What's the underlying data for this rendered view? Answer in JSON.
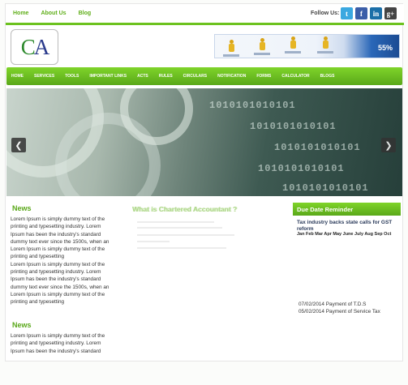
{
  "top_nav": [
    "Home",
    "About Us",
    "Blog"
  ],
  "follow_label": "Follow Us:",
  "social": [
    {
      "name": "twitter-icon",
      "glyph": "t",
      "color": "#3aa8e0"
    },
    {
      "name": "facebook-icon",
      "glyph": "f",
      "color": "#3b5ea8"
    },
    {
      "name": "linkedin-icon",
      "glyph": "in",
      "color": "#1b6fa8"
    },
    {
      "name": "googleplus-icon",
      "glyph": "g+",
      "color": "#444444"
    }
  ],
  "logo_text": "CA",
  "banner_percent": "55%",
  "main_nav": [
    "HOME",
    "SERVICES",
    "TOOLS",
    "IMPORTANT LINKS",
    "ACTS",
    "RULES",
    "CIRCULARS",
    "NOTIFICATION",
    "FORMS",
    "CALCULATOR",
    "BLOGS"
  ],
  "slider_binary": "1010101010101",
  "news": {
    "title": "News",
    "lines": [
      "Lorem Ipsum is simply dummy text of the",
      "printing and typesetting industry. Lorem",
      "Ipsum has been the industry's standard",
      "dummy text ever since the 1500s, when an",
      "Lorem Ipsum is simply dummy text of the",
      "printing and typesetting",
      "Lorem Ipsum is simply dummy text of the",
      "printing and typesetting industry. Lorem",
      "Ipsum has been the industry's standard",
      "dummy text ever since the 1500s, when an",
      "Lorem Ipsum is simply dummy text of the",
      "printing and typesetting"
    ]
  },
  "news2": {
    "title": "News",
    "lines": [
      "Lorem Ipsum is simply dummy text of the",
      "printing and typesetting industry. Lorem",
      "Ipsum has been the industry's standard"
    ]
  },
  "what_is": {
    "title": "What is Chartered Accountant ?"
  },
  "due_date": {
    "title": "Due Date Reminder",
    "headline": "Tax industry backs state calls for GST reform",
    "months": "Jan Feb Mar Apr May June July Aug Sep Oct",
    "payments": [
      "07/02/2014 Payment of T.D.S",
      "05/02/2014 Payment of Service Tax"
    ]
  }
}
